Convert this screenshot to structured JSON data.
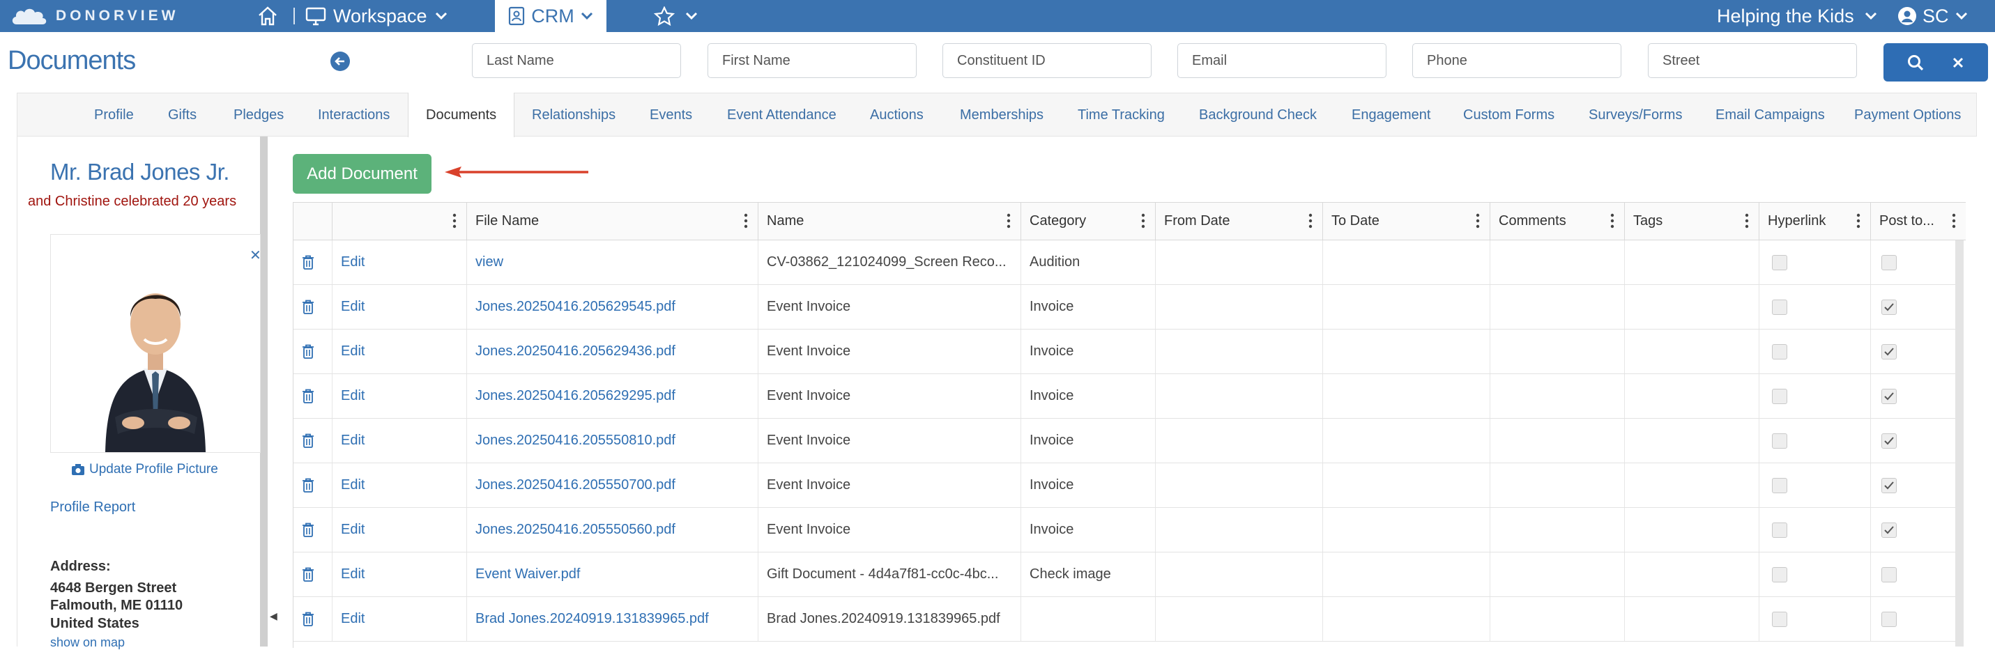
{
  "topnav": {
    "logo_text": "DONORVIEW",
    "workspace_label": "Workspace",
    "crm_label": "CRM",
    "org_label": "Helping the Kids",
    "user_initials": "SC"
  },
  "header": {
    "page_title": "Documents",
    "search_placeholders": {
      "last_name": "Last Name",
      "first_name": "First Name",
      "constituent_id": "Constituent ID",
      "email": "Email",
      "phone": "Phone",
      "street": "Street"
    }
  },
  "tabs": [
    {
      "label": "Profile"
    },
    {
      "label": "Gifts"
    },
    {
      "label": "Pledges"
    },
    {
      "label": "Interactions"
    },
    {
      "label": "Documents",
      "active": true
    },
    {
      "label": "Relationships"
    },
    {
      "label": "Events"
    },
    {
      "label": "Event Attendance"
    },
    {
      "label": "Auctions"
    },
    {
      "label": "Memberships"
    },
    {
      "label": "Time Tracking"
    },
    {
      "label": "Background Check"
    },
    {
      "label": "Engagement"
    },
    {
      "label": "Custom Forms"
    },
    {
      "label": "Surveys/Forms"
    },
    {
      "label": "Email Campaigns"
    },
    {
      "label": "Payment Options"
    }
  ],
  "constituent": {
    "name": "Mr. Brad Jones Jr.",
    "note": "and Christine celebrated 20 years",
    "update_picture_label": "Update Profile Picture",
    "profile_report_label": "Profile Report",
    "address_label": "Address:",
    "address_lines": [
      "4648 Bergen Street",
      "Falmouth, ME 01110",
      "United States"
    ],
    "show_map_label": "show on map"
  },
  "main": {
    "add_document_label": "Add Document"
  },
  "grid": {
    "columns": [
      "File Name",
      "Name",
      "Category",
      "From Date",
      "To Date",
      "Comments",
      "Tags",
      "Hyperlink",
      "Post to..."
    ],
    "edit_label": "Edit",
    "rows": [
      {
        "file": "view",
        "name": "CV-03862_121024099_Screen Reco...",
        "category": "Audition",
        "hyperlink": false,
        "post": false
      },
      {
        "file": "Jones.20250416.205629545.pdf",
        "name": "Event Invoice",
        "category": "Invoice",
        "hyperlink": false,
        "post": true
      },
      {
        "file": "Jones.20250416.205629436.pdf",
        "name": "Event Invoice",
        "category": "Invoice",
        "hyperlink": false,
        "post": true
      },
      {
        "file": "Jones.20250416.205629295.pdf",
        "name": "Event Invoice",
        "category": "Invoice",
        "hyperlink": false,
        "post": true
      },
      {
        "file": "Jones.20250416.205550810.pdf",
        "name": "Event Invoice",
        "category": "Invoice",
        "hyperlink": false,
        "post": true
      },
      {
        "file": "Jones.20250416.205550700.pdf",
        "name": "Event Invoice",
        "category": "Invoice",
        "hyperlink": false,
        "post": true
      },
      {
        "file": "Jones.20250416.205550560.pdf",
        "name": "Event Invoice",
        "category": "Invoice",
        "hyperlink": false,
        "post": true
      },
      {
        "file": "Event Waiver.pdf",
        "name": "Gift Document - 4d4a7f81-cc0c-4bc...",
        "category": "Check image",
        "hyperlink": false,
        "post": false
      },
      {
        "file": "Brad Jones.20240919.131839965.pdf",
        "name": "Brad Jones.20240919.131839965.pdf",
        "category": "",
        "hyperlink": false,
        "post": false
      }
    ]
  },
  "colors": {
    "brand_blue": "#3b73b0",
    "link_blue": "#2f6fb3",
    "add_green": "#5cb27a",
    "arrow_red": "#d9412b",
    "note_red": "#a0150f"
  }
}
